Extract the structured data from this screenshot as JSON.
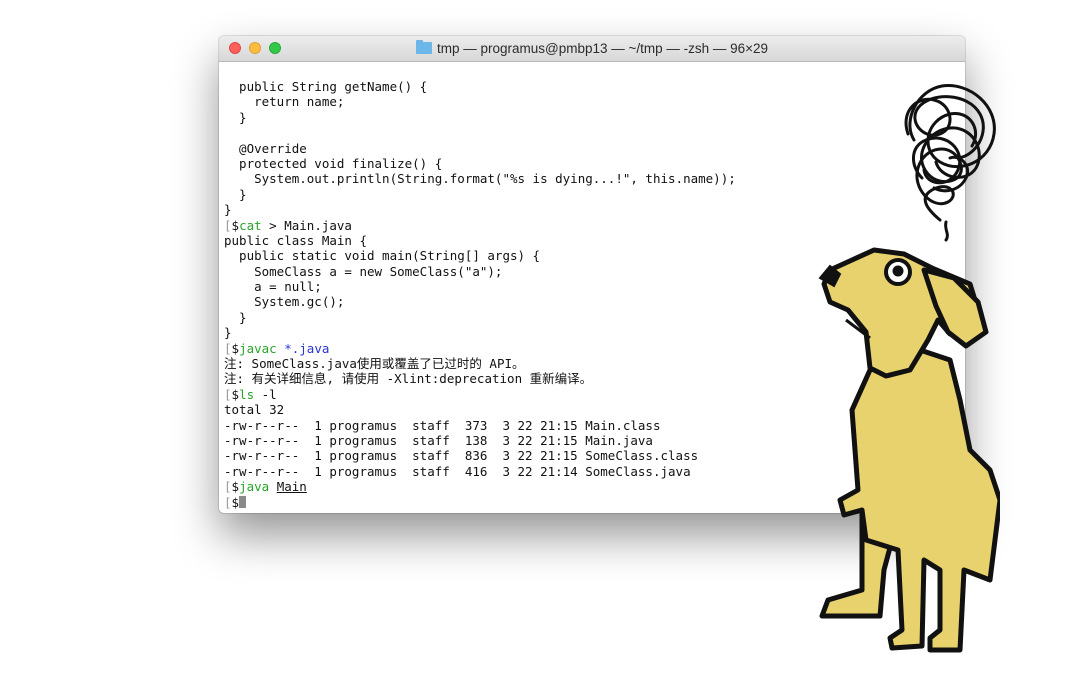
{
  "window": {
    "title": "tmp — programus@pmbp13 — ~/tmp — -zsh — 96×29",
    "folder_icon": "folder-icon"
  },
  "terminal": {
    "lines": [
      {
        "text": "  public String getName() {"
      },
      {
        "text": "    return name;"
      },
      {
        "text": "  }"
      },
      {
        "text": ""
      },
      {
        "text": "  @Override"
      },
      {
        "text": "  protected void finalize() {"
      },
      {
        "text": "    System.out.println(String.format(\"%s is dying...!\", this.name));"
      },
      {
        "text": "  }"
      },
      {
        "text": "}"
      },
      {
        "prompt": "$",
        "cmd": "cat",
        "rest": " > Main.java"
      },
      {
        "text": "public class Main {"
      },
      {
        "text": "  public static void main(String[] args) {"
      },
      {
        "text": "    SomeClass a = new SomeClass(\"a\");"
      },
      {
        "text": "    a = null;"
      },
      {
        "text": "    System.gc();"
      },
      {
        "text": "  }"
      },
      {
        "text": "}"
      },
      {
        "prompt": "$",
        "cmd": "javac",
        "sep": " ",
        "arg": "*.java",
        "arg_style": "blue"
      },
      {
        "text": "注: SomeClass.java使用或覆盖了已过时的 API。"
      },
      {
        "text": "注: 有关详细信息, 请使用 -Xlint:deprecation 重新编译。"
      },
      {
        "prompt": "$",
        "cmd": "ls",
        "rest": " -l"
      },
      {
        "text": "total 32"
      },
      {
        "text": "-rw-r--r--  1 programus  staff  373  3 22 21:15 Main.class"
      },
      {
        "text": "-rw-r--r--  1 programus  staff  138  3 22 21:15 Main.java"
      },
      {
        "text": "-rw-r--r--  1 programus  staff  836  3 22 21:15 SomeClass.class"
      },
      {
        "text": "-rw-r--r--  1 programus  staff  416  3 22 21:14 SomeClass.java"
      },
      {
        "prompt": "$",
        "cmd": "java",
        "sep": " ",
        "arg": "Main",
        "arg_style": "underline"
      },
      {
        "prompt": "$",
        "cursor": true
      }
    ]
  },
  "colors": {
    "command": "#2aa22a",
    "glob_arg": "#2a33d8",
    "dog_fill": "#e8d26e",
    "traffic_close": "#fc605c",
    "traffic_min": "#fdbc40",
    "traffic_max": "#34c84a"
  },
  "illustration": {
    "icon": "confused-dog-illustration",
    "thought_icon": "scribble-thought-icon"
  }
}
